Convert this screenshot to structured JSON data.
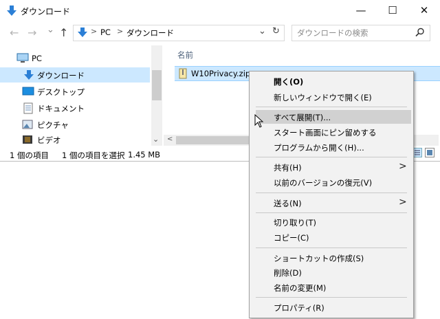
{
  "window": {
    "title": "ダウンロード",
    "controls": {
      "minimize": "—",
      "maximize": "☐",
      "close": "✕"
    }
  },
  "address": {
    "back": "←",
    "forward": "→",
    "recent": "⌄",
    "up": "↑",
    "crumbs": [
      "PC",
      "ダウンロード"
    ],
    "separator": ">",
    "dropdown": "⌄",
    "refresh": "↻"
  },
  "search": {
    "placeholder": "ダウンロードの検索"
  },
  "nav": {
    "items": [
      {
        "label": "PC",
        "icon": "pc-icon"
      },
      {
        "label": "ダウンロード",
        "icon": "download-icon",
        "selected": true
      },
      {
        "label": "デスクトップ",
        "icon": "desktop-icon"
      },
      {
        "label": "ドキュメント",
        "icon": "document-icon"
      },
      {
        "label": "ピクチャ",
        "icon": "picture-icon"
      },
      {
        "label": "ビデオ",
        "icon": "video-icon"
      }
    ],
    "scroll_down": "⌄"
  },
  "files": {
    "column_name": "名前",
    "items": [
      {
        "name": "W10Privacy.zip",
        "icon": "zip-icon"
      }
    ]
  },
  "status": {
    "count": "1 個の項目",
    "selected": "1 個の項目を選択",
    "size": "1.45 MB"
  },
  "context_menu": {
    "items": [
      {
        "label": "開く(O)",
        "bold": true
      },
      {
        "label": "新しいウィンドウで開く(E)"
      },
      {
        "label": "すべて展開(T)...",
        "highlighted": true
      },
      {
        "label": "スタート画面にピン留めする"
      },
      {
        "label": "プログラムから開く(H)..."
      },
      {
        "label": "共有(H)",
        "submenu": true
      },
      {
        "label": "以前のバージョンの復元(V)"
      },
      {
        "label": "送る(N)",
        "submenu": true
      },
      {
        "label": "切り取り(T)"
      },
      {
        "label": "コピー(C)"
      },
      {
        "label": "ショートカットの作成(S)"
      },
      {
        "label": "削除(D)"
      },
      {
        "label": "名前の変更(M)"
      },
      {
        "label": "プロパティ(R)"
      }
    ]
  },
  "colors": {
    "selection": "#cce8ff",
    "menu_bg": "#f2f2f2",
    "menu_highlight": "#d1d1d1",
    "folder_blue": "#2b7fd6"
  }
}
